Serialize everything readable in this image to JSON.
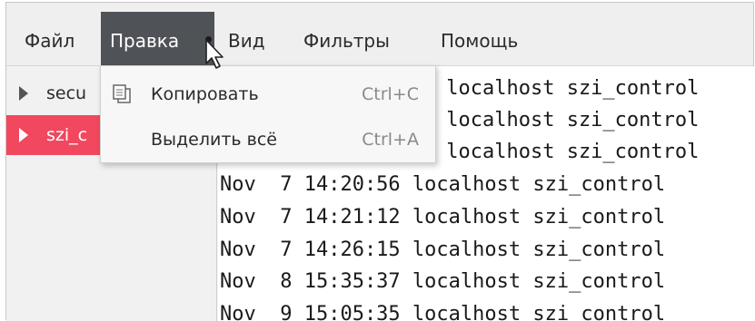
{
  "menubar": {
    "items": [
      {
        "label": "Файл"
      },
      {
        "label": "Правка"
      },
      {
        "label": "Вид"
      },
      {
        "label": "Фильтры"
      },
      {
        "label": "Помощь"
      }
    ],
    "active_index": 1
  },
  "sidebar": {
    "items": [
      {
        "label": "secu"
      },
      {
        "label": "szi_c"
      }
    ],
    "selected_index": 1
  },
  "dropdown": {
    "items": [
      {
        "label": "Копировать",
        "shortcut": "Ctrl+C",
        "icon": "copy-icon"
      },
      {
        "label": "Выделить всё",
        "shortcut": "Ctrl+A",
        "icon": ""
      }
    ]
  },
  "log": {
    "lines": [
      " localhost szi_control",
      " localhost szi_control",
      " localhost szi_control",
      "Nov  7 14:20:56 localhost szi_control",
      "Nov  7 14:21:12 localhost szi_control",
      "Nov  7 14:26:15 localhost szi_control",
      "Nov  8 15:35:37 localhost szi_control",
      "Nov  9 15:05:35 localhost szi_control"
    ]
  },
  "colors": {
    "menu_active_bg": "#4f5358",
    "selection_bg": "#f1485f"
  }
}
